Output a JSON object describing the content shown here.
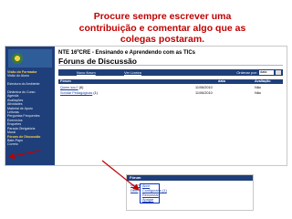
{
  "headline": {
    "line1": "Procure sempre escrever uma",
    "line2": "contribuição e comentar algo que as",
    "line3": "colegas postaram."
  },
  "colors": {
    "headline": "#c00000",
    "brand": "#1f3f7a",
    "highlight": "#ffd24a",
    "link": "#1a3ea8",
    "arrow": "#c00000"
  },
  "sidebar": {
    "items": [
      {
        "label": "Visão do Formador",
        "kind": "hdr"
      },
      {
        "label": "Visão do Aluno",
        "kind": "normal"
      },
      {
        "label": "",
        "kind": "normal"
      },
      {
        "label": "Estrutura do Ambiente",
        "kind": "normal"
      },
      {
        "label": "",
        "kind": "normal"
      },
      {
        "label": "Dinâmica do Curso",
        "kind": "normal"
      },
      {
        "label": "Agenda",
        "kind": "normal"
      },
      {
        "label": "Avaliações",
        "kind": "normal"
      },
      {
        "label": "Atividades",
        "kind": "normal"
      },
      {
        "label": "Material de Apoio",
        "kind": "normal"
      },
      {
        "label": "Leituras",
        "kind": "normal"
      },
      {
        "label": "Perguntas Frequentes",
        "kind": "normal"
      },
      {
        "label": "Exercícios",
        "kind": "normal"
      },
      {
        "label": "Enquetes",
        "kind": "normal"
      },
      {
        "label": "Parada Obrigatória",
        "kind": "normal"
      },
      {
        "label": "Mural",
        "kind": "normal"
      },
      {
        "label": "Fóruns de Discussão",
        "kind": "hl"
      },
      {
        "label": "Bate-Papo",
        "kind": "normal"
      },
      {
        "label": "Correio",
        "kind": "normal"
      }
    ]
  },
  "main": {
    "title": "NTE 16ºCRE - Ensinando e Aprendendo com as TICs",
    "subtitle": "Fóruns de Discussão",
    "toolbar": {
      "novo_forum": "Novo fórum",
      "ver_lixeira": "Ver Lixeira",
      "ordenar_label": "Ordenar por:",
      "ordenar_value": "data"
    },
    "table": {
      "headers": [
        "Fórum",
        "data",
        "Avaliação"
      ],
      "rows": [
        {
          "forum": "Quem sou?",
          "count": "(6)",
          "date": "11/06/2010",
          "avaliacao": "Não"
        },
        {
          "forum": "Sondar Pedagógicas",
          "count": "(1)",
          "date": "11/06/2010",
          "avaliacao": "Não"
        }
      ]
    }
  },
  "context": {
    "header": "Fórum",
    "row1_link": "Quem",
    "row2_link": "Dem",
    "row2_suffix": "ficas (1)",
    "menu": [
      "Abrir",
      "Configurar",
      "Renomear",
      "Apagar"
    ]
  }
}
